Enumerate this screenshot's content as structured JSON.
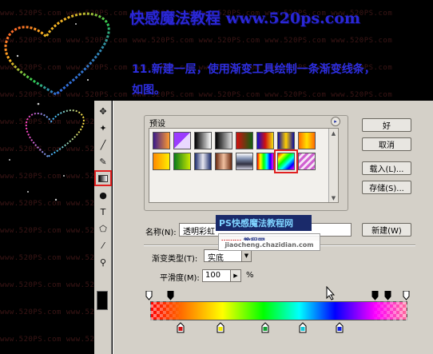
{
  "watermark_text": "www.520PS.com",
  "header": {
    "site_title": "快感魔法教程  www.520ps.com"
  },
  "instruction": {
    "line1": "11.新建一层，使用渐变工具绘制一条渐变线条，",
    "line2": "如图。"
  },
  "toolbox": {
    "tools": [
      {
        "name": "move-tool-icon",
        "glyph": "✥"
      },
      {
        "name": "magic-wand-icon",
        "glyph": "✦"
      },
      {
        "name": "brush-icon",
        "glyph": "╱"
      },
      {
        "name": "history-brush-icon",
        "glyph": "✎"
      },
      {
        "name": "gradient-tool-icon",
        "glyph": ""
      },
      {
        "name": "dodge-tool-icon",
        "glyph": "●"
      },
      {
        "name": "type-tool-icon",
        "glyph": "T"
      },
      {
        "name": "shape-tool-icon",
        "glyph": "⬠"
      },
      {
        "name": "eyedropper-icon",
        "glyph": "⁄"
      },
      {
        "name": "zoom-icon",
        "glyph": "⚲"
      }
    ],
    "selected_tool": "gradient-tool-icon"
  },
  "dialog": {
    "presets_label": "预设",
    "presets_menu_icon": "▸",
    "swatches": [
      {
        "name": "violet-orange",
        "bg": "linear-gradient(to right,#3a1a8a,#ff9a30)"
      },
      {
        "name": "violet-transparent",
        "bg": "linear-gradient(135deg,#9c3cff 50%,#e9d8ff 50%)"
      },
      {
        "name": "black-white",
        "bg": "linear-gradient(to right,#000,#fff)"
      },
      {
        "name": "white-black",
        "bg": "linear-gradient(to right,#000,#e0e0e0)"
      },
      {
        "name": "red-green",
        "bg": "linear-gradient(to right,#d21010,#106010)"
      },
      {
        "name": "blue-red-yellow",
        "bg": "linear-gradient(to right,#1010d0,#d01010,#f0e010)"
      },
      {
        "name": "blue-yellow-blue",
        "bg": "linear-gradient(to right,#0a0aa0,#ffd000,#0a0aa0)"
      },
      {
        "name": "orange-yellow",
        "bg": "linear-gradient(to right,#ff6a00,#ffe000,#ff6a00)"
      },
      {
        "name": "orange-yellow-orange",
        "bg": "linear-gradient(to right,#ff8a00,#ffee00)"
      },
      {
        "name": "green-yellow",
        "bg": "linear-gradient(to right,#0a7a1a,#c8e800)"
      },
      {
        "name": "blue-steel",
        "bg": "linear-gradient(to right,#1a2a6a,#e8e8f0,#1a2a6a)"
      },
      {
        "name": "copper",
        "bg": "linear-gradient(to right,#6a2a10,#f0c0a0,#6a2a10)"
      },
      {
        "name": "chrome",
        "bg": "linear-gradient(to bottom,#ffffff,#8090b0,#303040,#d0d0e0)"
      },
      {
        "name": "rainbow",
        "bg": "linear-gradient(to right,#ff0000,#ffff00,#00ff00,#00ffff,#0000ff,#ff00ff)"
      },
      {
        "name": "transparent-rainbow",
        "bg": "linear-gradient(135deg,#ff0000,#ffff00,#00ff00,#00ffff,#0000ff,#ff00ff)"
      },
      {
        "name": "transparent-stripes",
        "bg": "repeating-linear-gradient(135deg,#d060d0 0 3px,#f6e6f6 3px 6px)"
      }
    ],
    "selected_swatch_index": 14,
    "buttons": {
      "ok": "好",
      "cancel": "取消",
      "load": "载入(L)...",
      "save": "存储(S)...",
      "new": "新建(W)"
    },
    "name_label": "名称(N):",
    "name_value": "透明彩虹",
    "gradient_type_label": "渐变类型(T):",
    "gradient_type_value": "实底",
    "smoothness_label": "平滑度(M):",
    "smoothness_value": "100",
    "smoothness_unit": "%",
    "color_stop_colors": [
      "#d01515",
      "#f2e800",
      "#10a030",
      "#10c8d8",
      "#1020e0"
    ],
    "colors": {
      "dialog_bg": "#d4d0c8",
      "highlight": "#e02020",
      "header_text": "#2a27d6"
    }
  },
  "overlay_watermark": {
    "badge": "PS快感魔法教程网",
    "site_prefix": "教程网",
    "site_red": "www.",
    "url": "jiaocheng.chazidian.com"
  }
}
